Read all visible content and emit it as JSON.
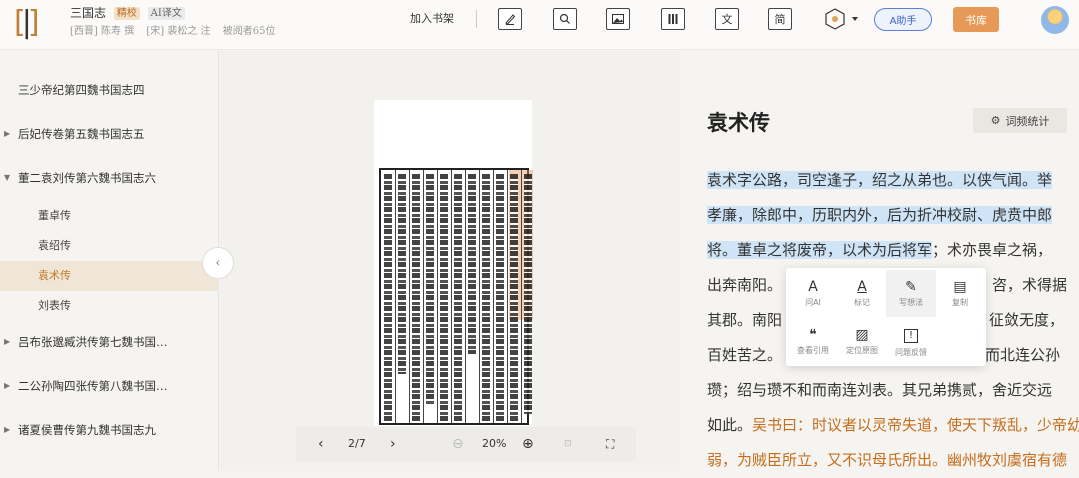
{
  "header": {
    "book_title": "三国志",
    "proof_badge": "精校",
    "ai_badge": "AI译文",
    "author": "[西晋] 陈寿 撰",
    "annotator": "[宋] 裴松之 注",
    "readers": "被阅者65位",
    "add_shelf": "加入书架",
    "tool_wen": "文",
    "tool_jian": "简",
    "ai_assistant": "A助手",
    "library": "书库"
  },
  "sidebar": {
    "items": [
      {
        "label": "三少帝纪第四魏书国志四"
      },
      {
        "label": "后妃传卷第五魏书国志五"
      },
      {
        "label": "董二袁刘传第六魏书国志六"
      },
      {
        "label": "董卓传"
      },
      {
        "label": "袁绍传"
      },
      {
        "label": "袁术传"
      },
      {
        "label": "刘表传"
      },
      {
        "label": "吕布张邈臧洪传第七魏书国…"
      },
      {
        "label": "二公孙陶四张传第八魏书国…"
      },
      {
        "label": "诸夏侯曹传第九魏书国志九"
      }
    ]
  },
  "viewer": {
    "page": "2/7",
    "zoom": "20%"
  },
  "reader": {
    "title": "袁术传",
    "freq_button": "词频统计",
    "lines": [
      {
        "sel": "袁术字公路，司空逢子，绍之从弟也。以侠气闻。举",
        "rest": ""
      },
      {
        "sel": "孝廉，除郎中，历职内外，后为折冲校尉、虎贲中郎",
        "rest": ""
      },
      {
        "sel": "将。董卓之将废帝，以术为后将军",
        "rest": "；术亦畏卓之祸，"
      },
      {
        "sel": "",
        "rest": "出奔南阳。"
      },
      {
        "sel": "",
        "rest": "其郡。南阳"
      },
      {
        "sel": "",
        "rest": "百姓苦之。"
      },
      {
        "sel": "",
        "rest": "瓒；绍与瓒不和而南连刘表。其兄弟携贰，舍近交远"
      },
      {
        "sel": "",
        "rest": "如此。",
        "note": "吴书曰：时议者以灵帝失道，使天下叛乱，少帝幼"
      },
      {
        "sel": "",
        "rest": "",
        "note": "弱，为贼臣所立，又不识母氏所出。幽州牧刘虞宿有德"
      }
    ],
    "tail_right": [
      {
        "text": "，咨，术得据"
      },
      {
        "text": "征敛无度，"
      },
      {
        "text": "而北连公孙"
      }
    ]
  },
  "popup": {
    "items": [
      {
        "label": "问AI",
        "icon": "A"
      },
      {
        "label": "标记",
        "icon": "A"
      },
      {
        "label": "写想法",
        "icon": "✎"
      },
      {
        "label": "复制",
        "icon": "▤"
      },
      {
        "label": "查看引用",
        "icon": "❝"
      },
      {
        "label": "定位原图",
        "icon": "▨"
      },
      {
        "label": "问题反馈",
        "icon": "!"
      }
    ]
  },
  "colors": {
    "accent": "#e79a57",
    "selection": "#cfe4f6",
    "annotation": "#c56d1d",
    "ai": "#3b5fcf"
  }
}
